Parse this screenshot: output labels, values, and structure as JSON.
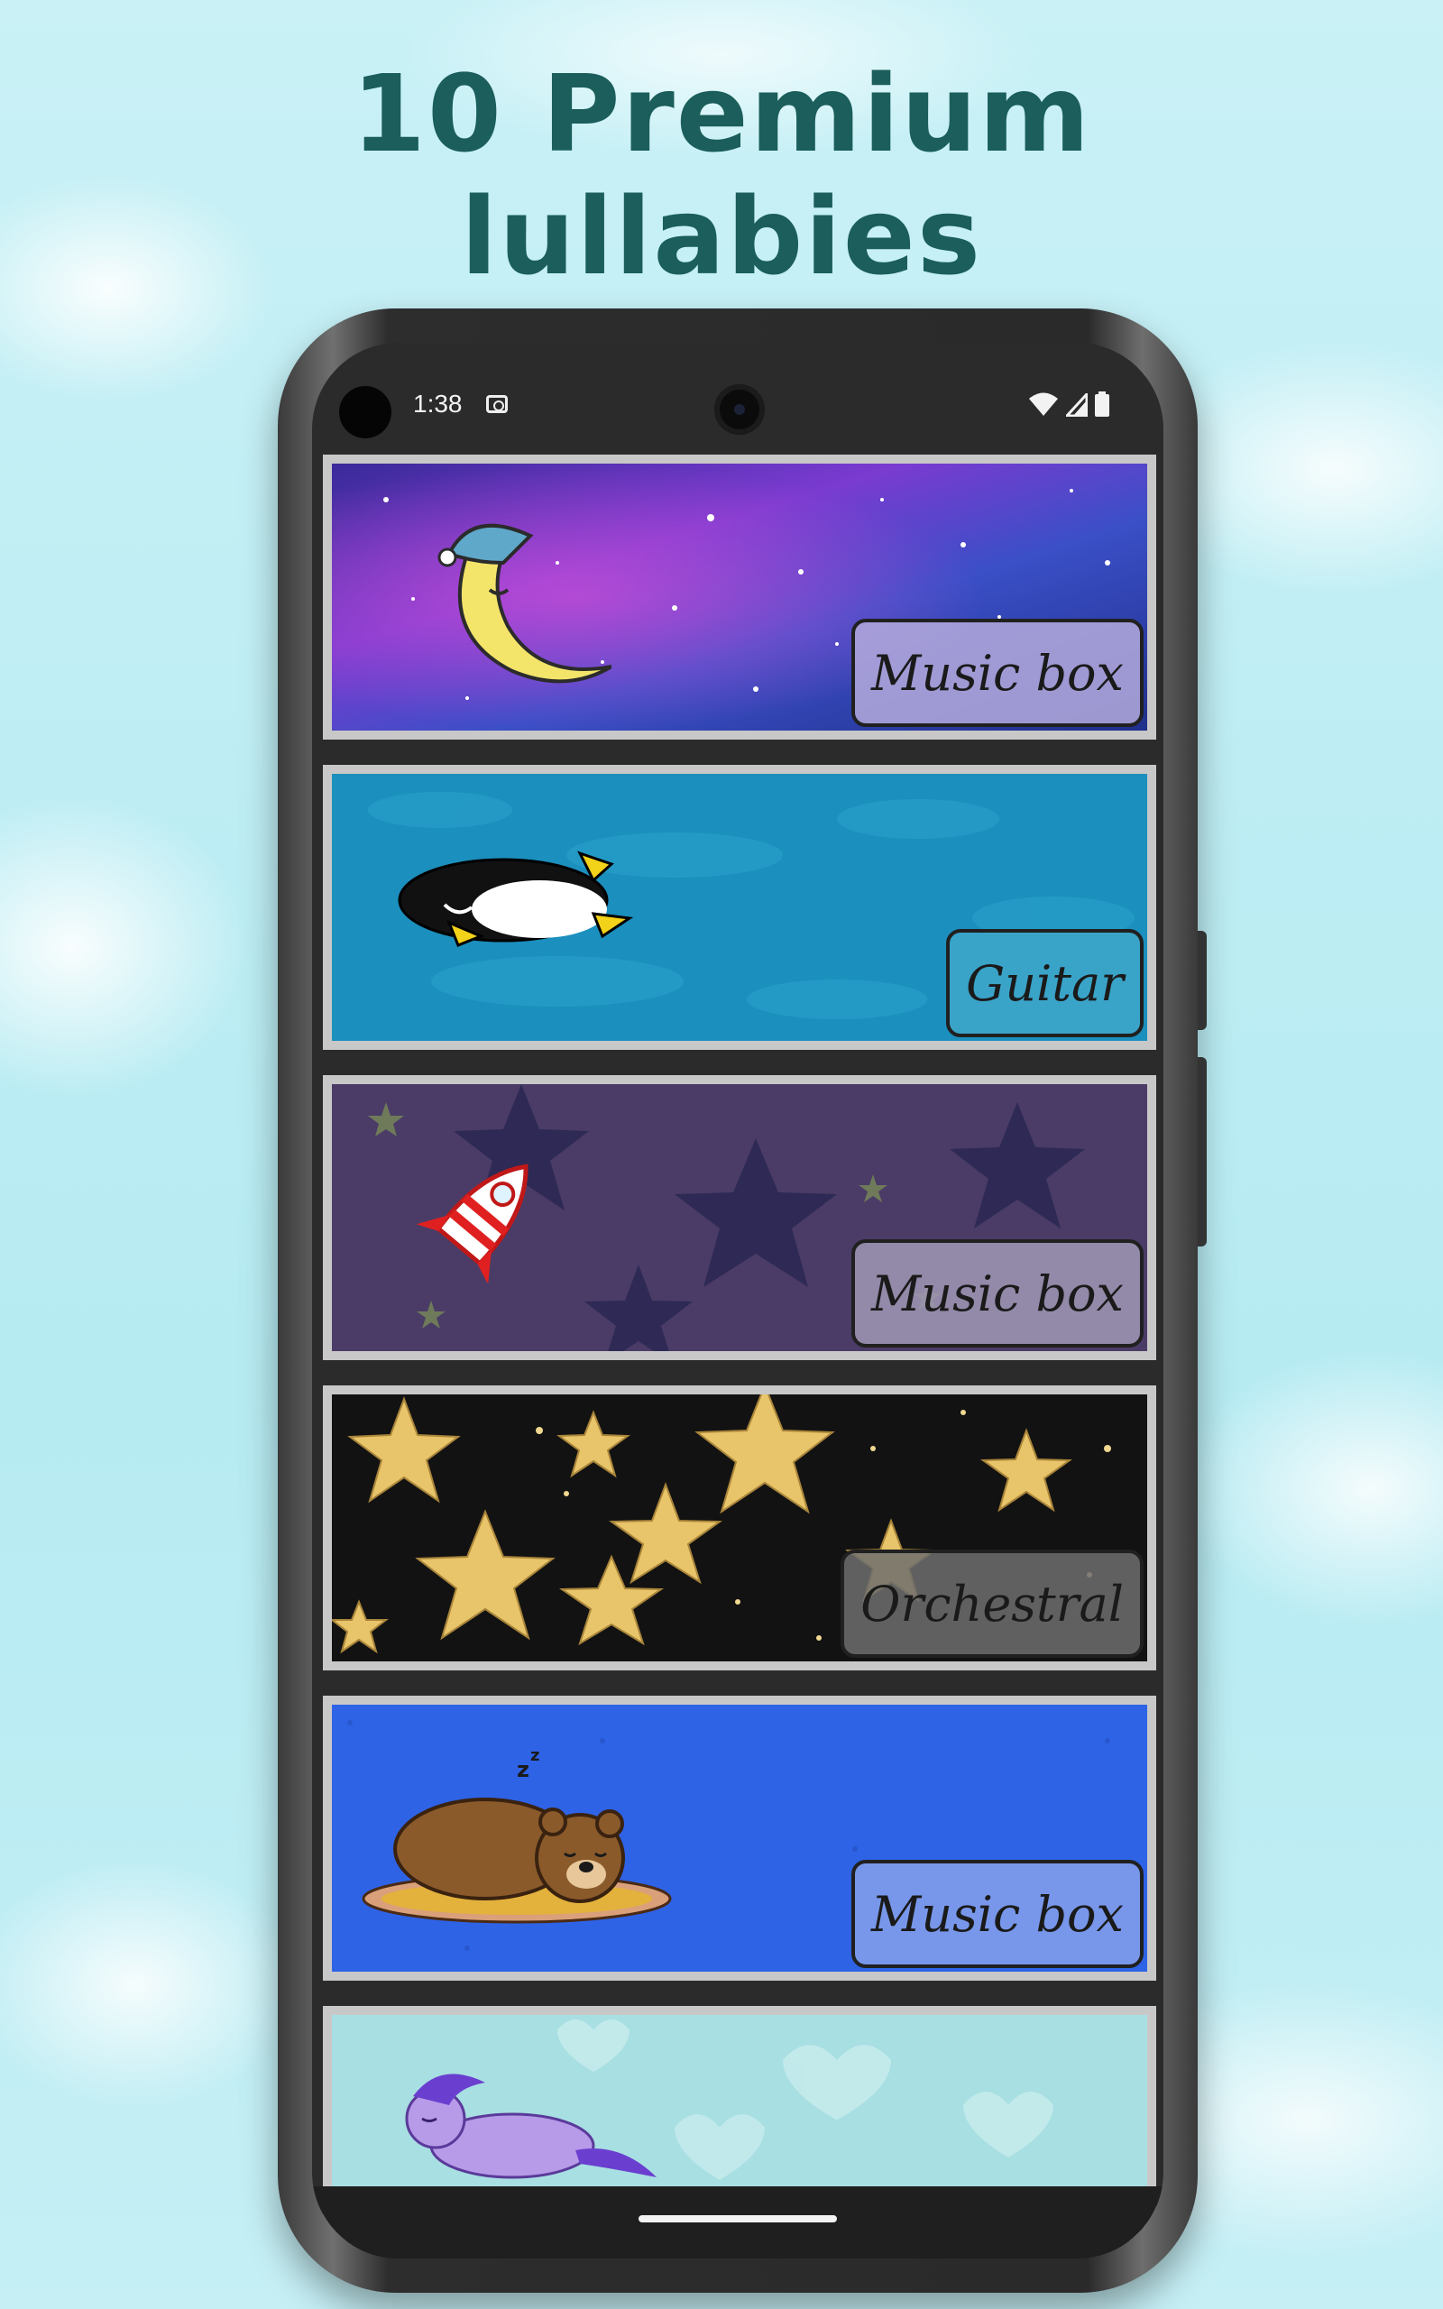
{
  "headline": {
    "line1": "10 Premium",
    "line2": "lullabies"
  },
  "status_bar": {
    "time": "1:38",
    "icons": [
      "screenshot-icon",
      "wifi-icon",
      "signal-icon",
      "battery-icon"
    ]
  },
  "lullabies": [
    {
      "instrument": "Music box",
      "scene": "sleeping moon with nightcap in galaxy",
      "bg": "#5a3fb8",
      "tag_bg": "#a99ad6"
    },
    {
      "instrument": "Guitar",
      "scene": "sleeping penguin on blue water",
      "bg": "#1b8fbe",
      "tag_bg": "#3aa3c8"
    },
    {
      "instrument": "Music box",
      "scene": "striped rocket among stars",
      "bg": "#4a3c66",
      "tag_bg": "#8a7d9c"
    },
    {
      "instrument": "Orchestral",
      "scene": "golden stars on black",
      "bg": "#141414",
      "tag_bg": "#5a5a5a"
    },
    {
      "instrument": "Music box",
      "scene": "sleeping bear on rug",
      "bg": "#2e63e6",
      "tag_bg": "#7897ea"
    },
    {
      "instrument": "",
      "scene": "sleeping purple pony on hearts",
      "bg": "#a8dfe2",
      "tag_bg": "#b8e4e6"
    }
  ],
  "colors": {
    "headline": "#1b5e5c",
    "screen": "#2b2b2b",
    "card_border": "#c8c8c8"
  }
}
